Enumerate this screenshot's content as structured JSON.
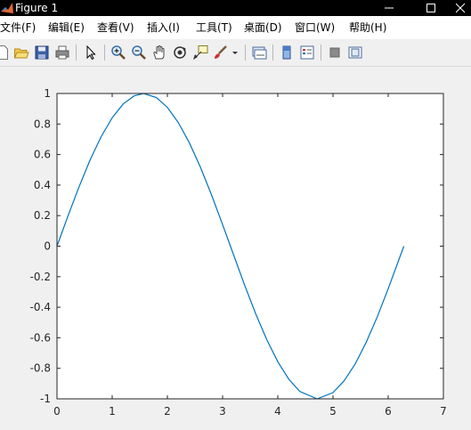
{
  "window": {
    "title": "Figure 1"
  },
  "menu": {
    "items": [
      {
        "label": "文件(F)"
      },
      {
        "label": "编辑(E)"
      },
      {
        "label": "查看(V)"
      },
      {
        "label": "插入(I)"
      },
      {
        "label": "工具(T)"
      },
      {
        "label": "桌面(D)"
      },
      {
        "label": "窗口(W)"
      },
      {
        "label": "帮助(H)"
      }
    ]
  },
  "toolbar": {
    "icons": [
      "new-file-icon",
      "open-folder-icon",
      "save-icon",
      "print-icon",
      "pointer-icon",
      "zoom-in-icon",
      "zoom-out-icon",
      "pan-hand-icon",
      "rotate-3d-icon",
      "data-cursor-icon",
      "brush-icon",
      "dropdown-arrow-icon",
      "link-plot-icon",
      "colorbar-icon",
      "legend-icon",
      "hide-plot-tools-icon",
      "show-plot-tools-icon"
    ]
  },
  "chart_data": {
    "type": "line",
    "title": "",
    "xlabel": "",
    "ylabel": "",
    "xlim": [
      0,
      7
    ],
    "ylim": [
      -1,
      1
    ],
    "x_ticks": [
      "0",
      "1",
      "2",
      "3",
      "4",
      "5",
      "6",
      "7"
    ],
    "y_ticks": [
      "-1",
      "-0.8",
      "-0.6",
      "-0.4",
      "-0.2",
      "0",
      "0.2",
      "0.4",
      "0.6",
      "0.8",
      "1"
    ],
    "grid": false,
    "series": [
      {
        "color": "#0072bd",
        "x": [
          0,
          0.2,
          0.4,
          0.6,
          0.8,
          1.0,
          1.2,
          1.4,
          1.5708,
          1.8,
          2.0,
          2.2,
          2.4,
          2.6,
          2.8,
          3.0,
          3.1416,
          3.4,
          3.6,
          3.8,
          4.0,
          4.2,
          4.4,
          4.7124,
          5.0,
          5.2,
          5.4,
          5.6,
          5.8,
          6.0,
          6.2832
        ],
        "y": [
          0,
          0.199,
          0.389,
          0.565,
          0.717,
          0.841,
          0.932,
          0.985,
          1.0,
          0.974,
          0.909,
          0.808,
          0.675,
          0.516,
          0.335,
          0.141,
          0,
          -0.256,
          -0.443,
          -0.612,
          -0.757,
          -0.872,
          -0.952,
          -1.0,
          -0.959,
          -0.883,
          -0.773,
          -0.631,
          -0.465,
          -0.279,
          0
        ]
      }
    ]
  }
}
